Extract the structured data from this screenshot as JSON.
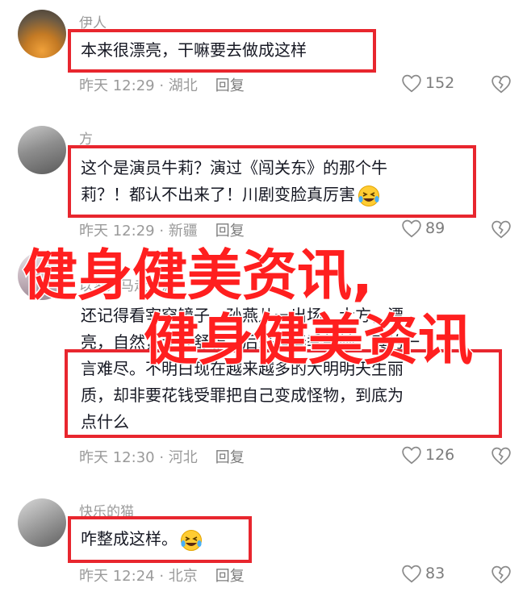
{
  "comments": [
    {
      "username": "伊人",
      "text_lines": [
        "本来很漂亮，干嘛要去做成这样"
      ],
      "time_location": "昨天 12:29 · 湖北",
      "reply_label": "回复",
      "likes": "152",
      "emoji": ""
    },
    {
      "username": "方",
      "text_lines": [
        "这个是演员牛莉？演过《闯关东》的那个牛",
        "莉？！都认不出来了！川剧变脸真厉害"
      ],
      "time_location": "昨天 12:29 · 新疆",
      "reply_label": "回复",
      "likes": "89",
      "emoji": "grinning-squint-tears-emoji"
    },
    {
      "username": "以梦为马走天涯",
      "text_lines": [
        "还记得看宰穿镜子，孙燕儿一出场，大方，漂",
        "亮，自然，让人舒服，后来是春季新她，真的一",
        "言难尽。不明白现在越来越多的大明明天生丽",
        "质，却非要花钱受罪把自己变成怪物，到底为",
        "点什么"
      ],
      "time_location": "昨天 12:30 · 河北",
      "reply_label": "回复",
      "likes": "126",
      "emoji": ""
    },
    {
      "username": "快乐的猫",
      "text_lines": [
        "咋整成这样。"
      ],
      "time_location": "昨天 12:24 · 北京",
      "reply_label": "回复",
      "likes": "83",
      "emoji": "grinning-squint-tears-emoji"
    }
  ],
  "watermark": {
    "line1": "健身健美资讯,",
    "line2": "健身健美资讯"
  },
  "colors": {
    "highlight_border": "#e8262e",
    "watermark": "#ff1f1f",
    "meta_text": "#9a9a9a"
  }
}
